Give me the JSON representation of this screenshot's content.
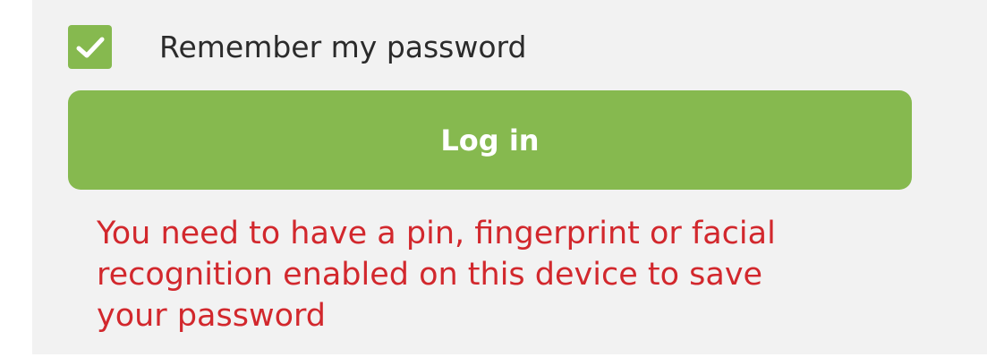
{
  "colors": {
    "accent_green": "#86b94f",
    "error_red": "#d2282d",
    "panel_background": "#f2f2f2"
  },
  "remember": {
    "label": "Remember my password",
    "checked": true,
    "icon": "check-icon"
  },
  "login": {
    "button_label": "Log in"
  },
  "error": {
    "lines": [
      "You need to have a pin, fingerprint or facial",
      "recognition enabled on this device to save",
      "your password"
    ]
  }
}
